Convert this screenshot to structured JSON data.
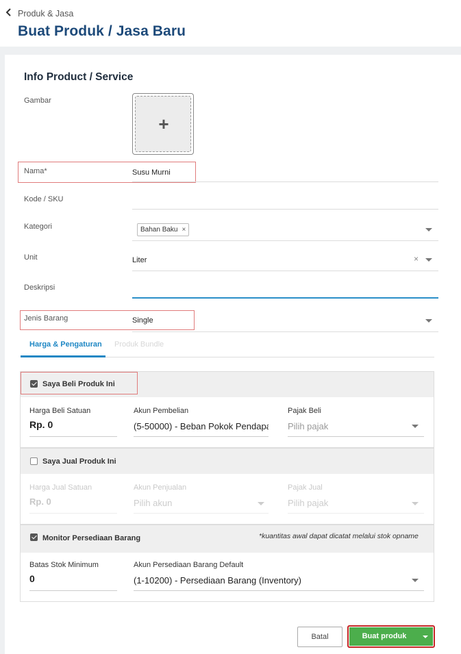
{
  "header": {
    "breadcrumb": "Produk & Jasa",
    "title": "Buat Produk / Jasa Baru"
  },
  "info": {
    "section_title": "Info Product / Service",
    "image_label": "Gambar",
    "image_add_symbol": "+",
    "name_label": "Nama*",
    "name_value": "Susu Murni",
    "sku_label": "Kode / SKU",
    "sku_value": "",
    "category_label": "Kategori",
    "category_tag": "Bahan Baku",
    "category_tag_remove": "×",
    "unit_label": "Unit",
    "unit_value": "Liter",
    "unit_clear": "×",
    "description_label": "Deskripsi",
    "description_value": "",
    "type_label": "Jenis Barang",
    "type_value": "Single"
  },
  "tabs": [
    {
      "label": "Harga & Pengaturan",
      "active": true
    },
    {
      "label": "Produk Bundle",
      "active": false
    }
  ],
  "buy": {
    "checkbox_label": "Saya Beli Produk Ini",
    "checked": true,
    "price_label": "Harga Beli Satuan",
    "price_value": "Rp. 0",
    "account_label": "Akun Pembelian",
    "account_value": "(5-50000) - Beban Pokok Pendapa",
    "tax_label": "Pajak Beli",
    "tax_placeholder": "Pilih pajak"
  },
  "sell": {
    "checkbox_label": "Saya Jual Produk Ini",
    "checked": false,
    "price_label": "Harga Jual Satuan",
    "price_value": "Rp. 0",
    "account_label": "Akun Penjualan",
    "account_placeholder": "Pilih akun",
    "tax_label": "Pajak Jual",
    "tax_placeholder": "Pilih pajak"
  },
  "inventory": {
    "checkbox_label": "Monitor Persediaan Barang",
    "checked": true,
    "note": "*kuantitas awal dapat dicatat melalui stok opname",
    "min_stock_label": "Batas Stok Minimum",
    "min_stock_value": "0",
    "account_label": "Akun Persediaan Barang Default",
    "account_value": "(1-10200) - Persediaan Barang (Inventory)"
  },
  "footer": {
    "cancel_label": "Batal",
    "create_label": "Buat produk"
  },
  "colors": {
    "title": "#1d4a7a",
    "tab_active": "#1e87c4",
    "create_button": "#4cae4c",
    "highlight_border": "#e07b7b",
    "create_highlight": "#c62828"
  }
}
